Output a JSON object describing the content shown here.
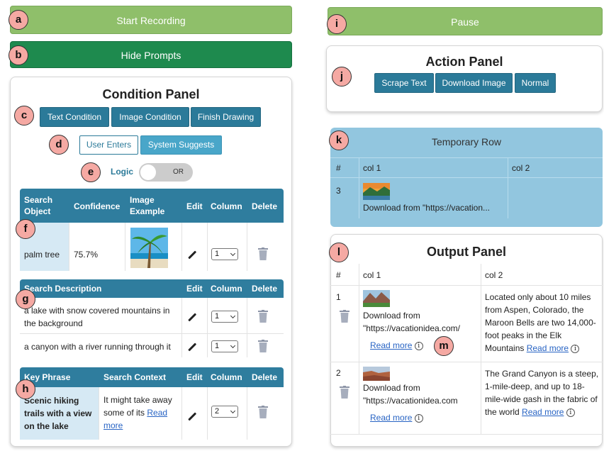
{
  "buttons": {
    "start_recording": "Start Recording",
    "hide_prompts": "Hide Prompts",
    "pause": "Pause"
  },
  "badges": {
    "a": "a",
    "b": "b",
    "c": "c",
    "d": "d",
    "e": "e",
    "f": "f",
    "g": "g",
    "h": "h",
    "i": "i",
    "j": "j",
    "k": "k",
    "l": "l",
    "m": "m"
  },
  "condition_panel": {
    "title": "Condition Panel",
    "tabs": [
      "Text Condition",
      "Image Condition",
      "Finish Drawing"
    ],
    "toggle": [
      "User Enters",
      "System Suggests"
    ],
    "logic_label": "Logic",
    "logic_value": "OR",
    "object_table": {
      "headers": [
        "Search Object",
        "Confidence",
        "Image Example",
        "Edit",
        "Column",
        "Delete"
      ],
      "rows": [
        {
          "object": "palm tree",
          "confidence": "75.7%",
          "column": "1"
        }
      ]
    },
    "description_table": {
      "headers": [
        "Search Description",
        "Edit",
        "Column",
        "Delete"
      ],
      "rows": [
        {
          "text": "a lake with snow covered mountains in the background",
          "column": "1"
        },
        {
          "text": "a canyon with a river running through it",
          "column": "1"
        }
      ]
    },
    "phrase_table": {
      "headers": [
        "Key Phrase",
        "Search Context",
        "Edit",
        "Column",
        "Delete"
      ],
      "rows": [
        {
          "phrase": "Scenic hiking trails with a view on the lake",
          "context": "It might take away some of its",
          "read_more": "Read more",
          "column": "2"
        }
      ]
    }
  },
  "action_panel": {
    "title": "Action Panel",
    "buttons": [
      "Scrape Text",
      "Download Image",
      "Normal"
    ]
  },
  "temp_row": {
    "title": "Temporary Row",
    "headers": [
      "#",
      "col 1",
      "col 2"
    ],
    "row": {
      "num": "3",
      "text": "Download from \"https://vacation..."
    }
  },
  "output_panel": {
    "title": "Output Panel",
    "headers": [
      "#",
      "col 1",
      "col 2"
    ],
    "rows": [
      {
        "num": "1",
        "col1": "Download from \"https://vacationidea.com/",
        "read_more": "Read more",
        "col2": "Located only about 10 miles from Aspen, Colorado, the Maroon Bells are two 14,000-foot peaks in the Elk Mountains",
        "read_more2": "Read more"
      },
      {
        "num": "2",
        "col1": "Download from \"https://vacationidea.com",
        "read_more": "Read more",
        "col2": "The Grand Canyon is a steep, 1-mile-deep, and up to 18-mile-wide gash in the fabric of the world",
        "read_more2": "Read more"
      }
    ]
  },
  "icons": {
    "edit": "pencil-icon",
    "delete": "trash-icon",
    "info": "info-icon"
  },
  "colors": {
    "green_light": "#8fbf6a",
    "green_dark": "#1e8a4e",
    "accent": "#2b7a99",
    "header": "#2f7d9e",
    "temp_bg": "#92c6df",
    "badge": "#f5a9a3"
  }
}
